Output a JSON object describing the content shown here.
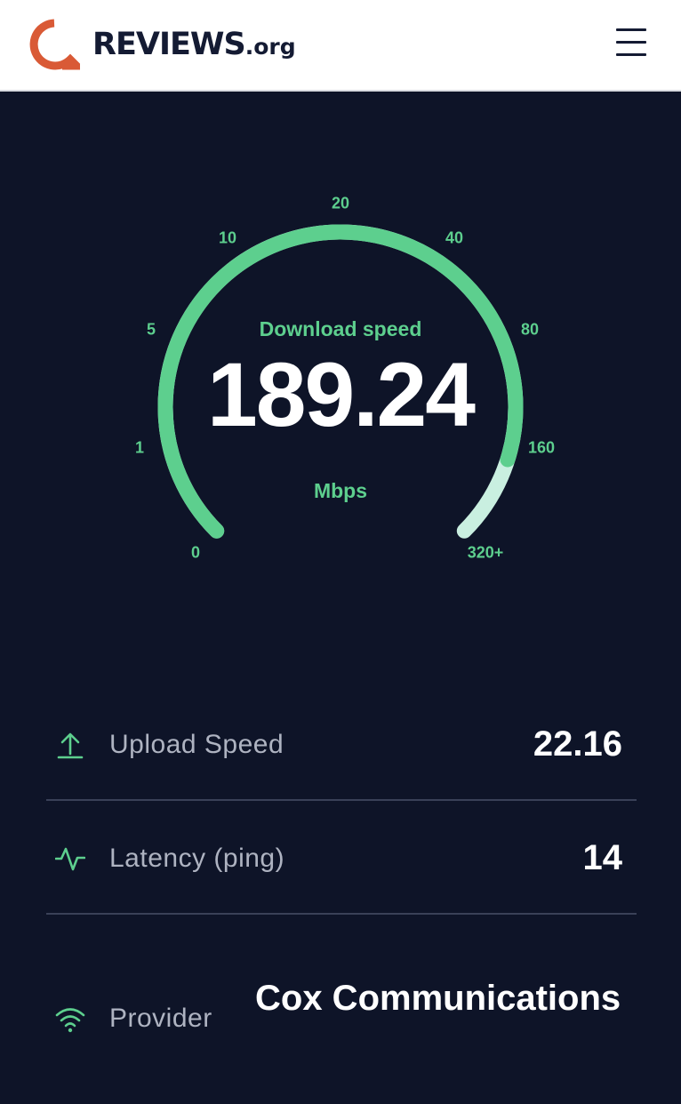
{
  "header": {
    "logo_text": "REVIEWS",
    "logo_tld": ".org",
    "brand_color": "#d95a36"
  },
  "gauge": {
    "label": "Download speed",
    "value": "189.24",
    "unit": "Mbps",
    "ticks": [
      "0",
      "1",
      "5",
      "10",
      "20",
      "40",
      "80",
      "160",
      "320+"
    ],
    "arc_color": "#5dcf8e",
    "arc_track_color": "#c9efe0"
  },
  "stats": {
    "upload": {
      "label": "Upload Speed",
      "value": "22.16",
      "icon": "upload-icon"
    },
    "latency": {
      "label": "Latency (ping)",
      "value": "14",
      "icon": "pulse-icon"
    },
    "provider": {
      "label": "Provider",
      "value": "Cox Communications",
      "icon": "wifi-icon"
    }
  }
}
